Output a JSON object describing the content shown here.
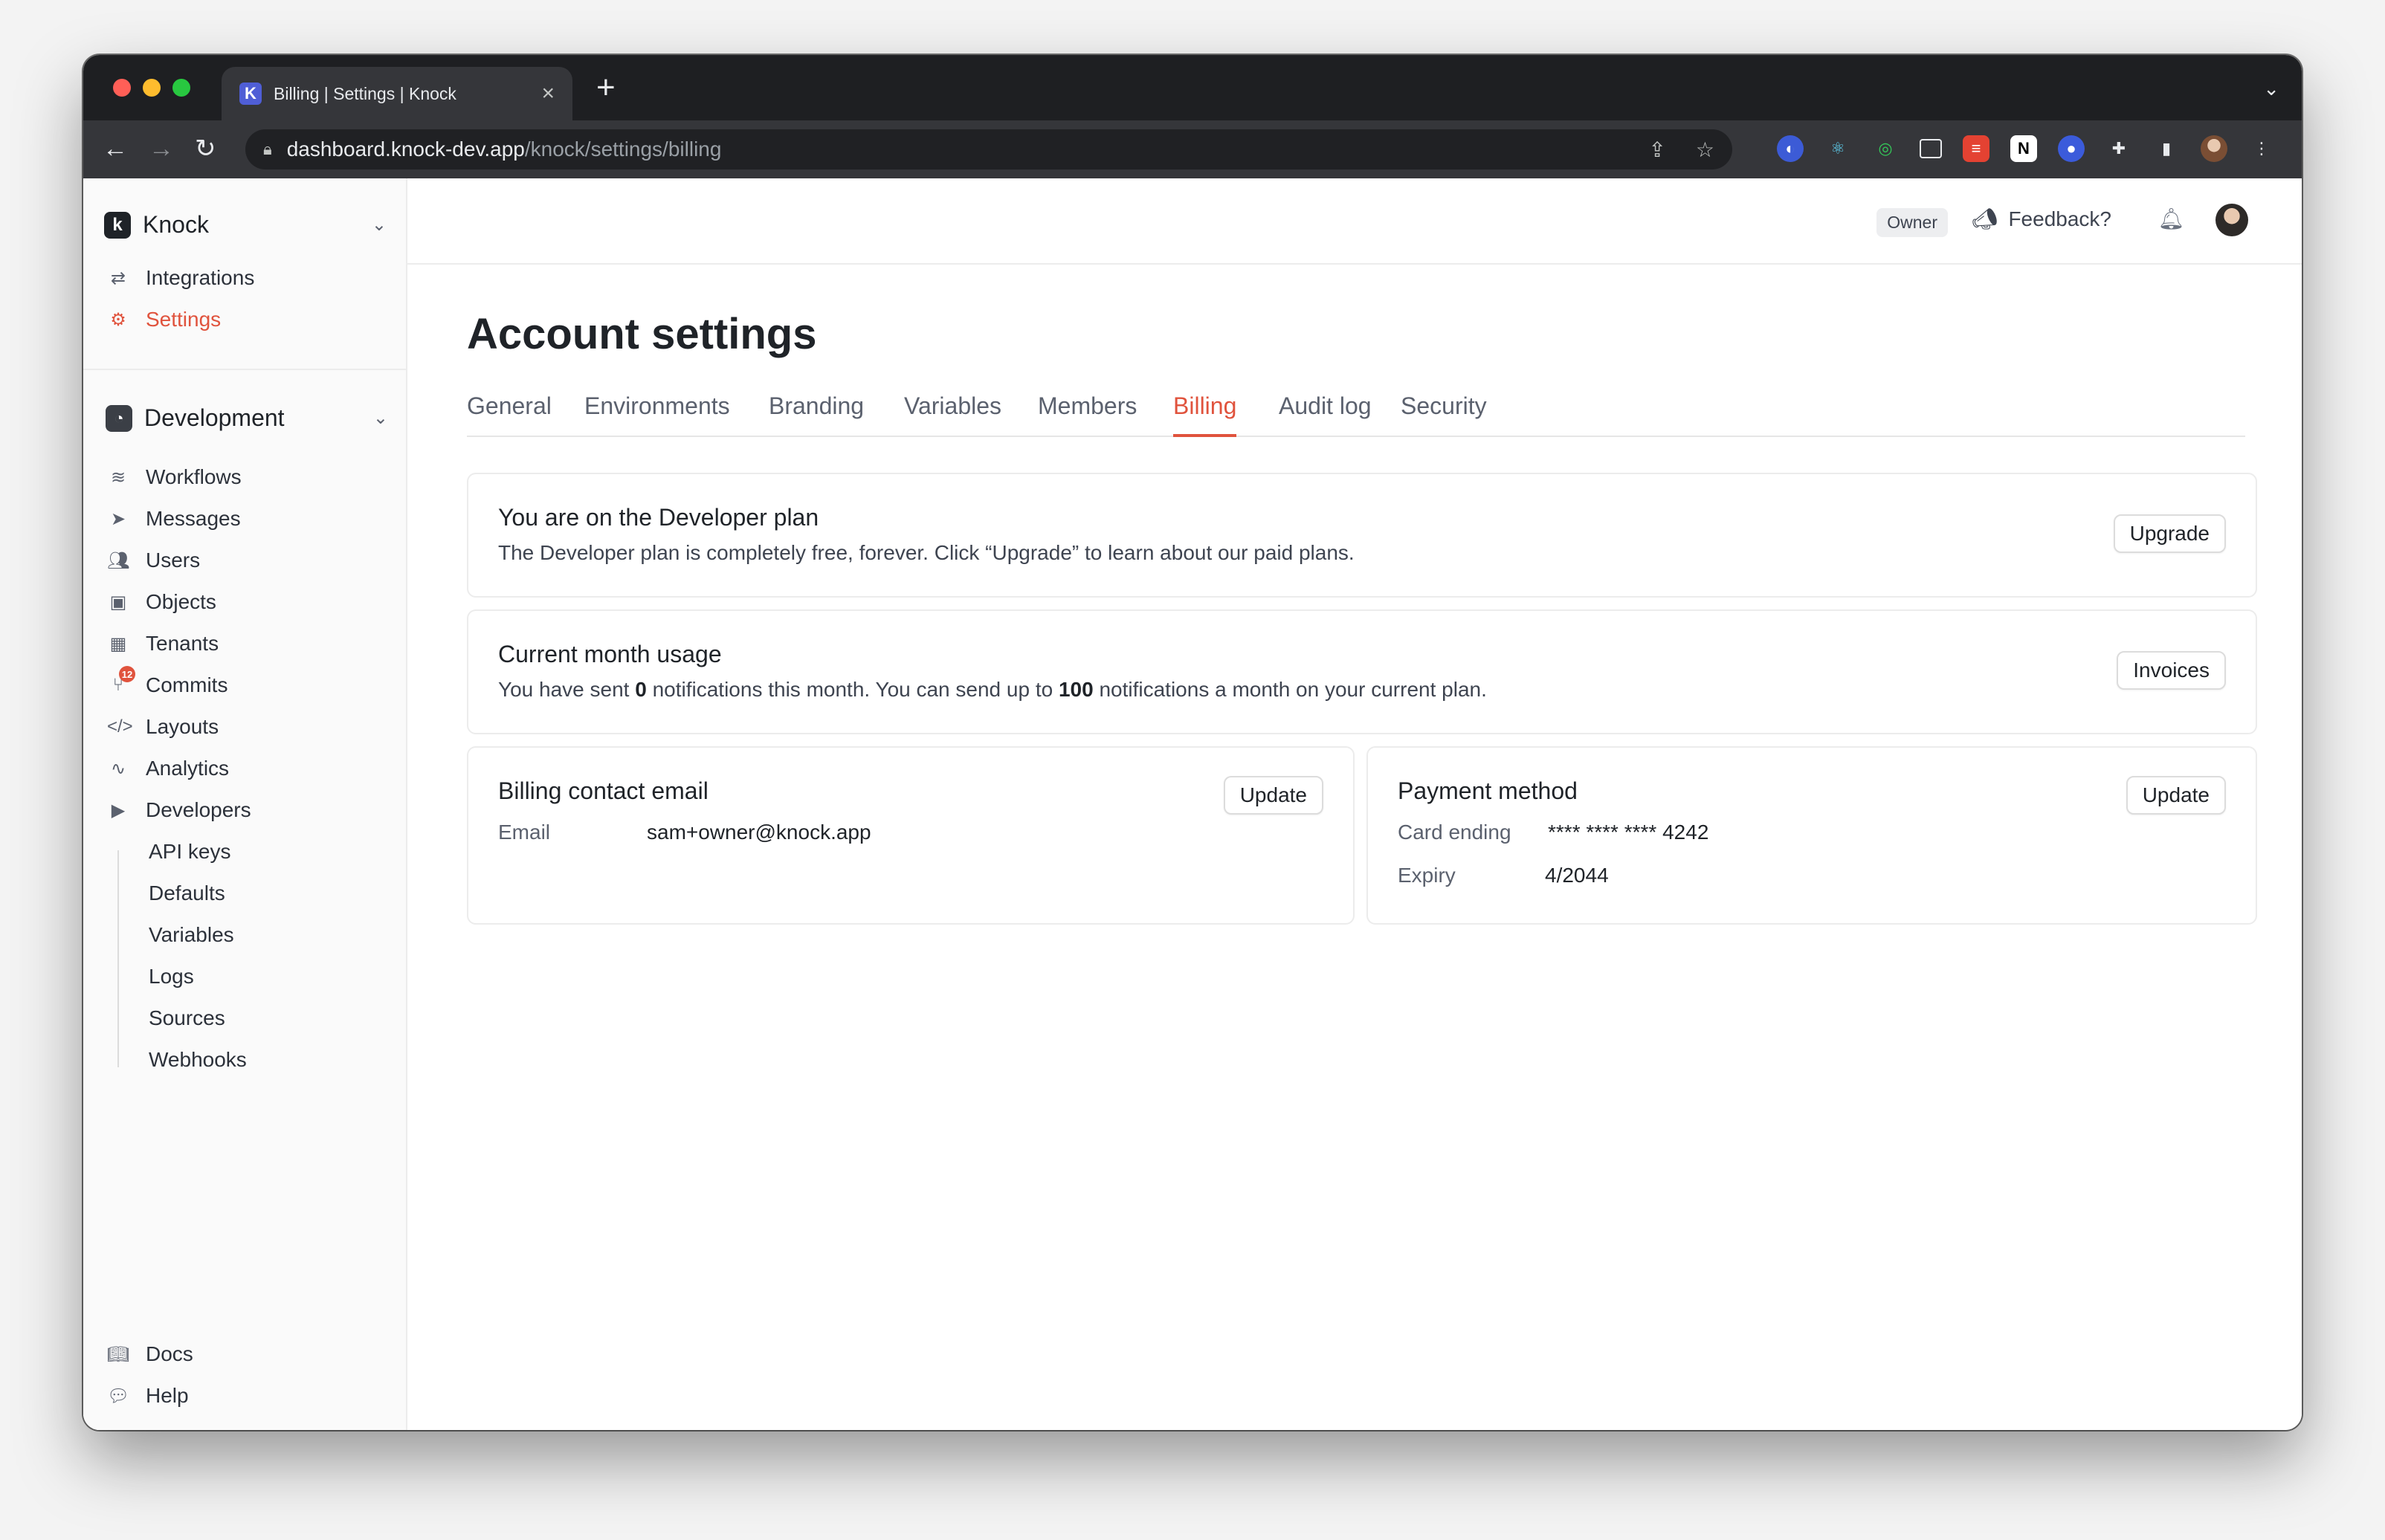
{
  "browser": {
    "tab_title": "Billing | Settings | Knock",
    "tab_favicon_letter": "K",
    "url_host": "dashboard.knock-dev.app",
    "url_path": "/knock/settings/billing"
  },
  "sidebar": {
    "brand": "Knock",
    "top_items": [
      {
        "label": "Integrations",
        "icon": "arrows-exchange-icon"
      },
      {
        "label": "Settings",
        "icon": "gear-icon",
        "active": true
      }
    ],
    "environment": "Development",
    "env_items": [
      {
        "label": "Workflows",
        "icon": "layers-icon"
      },
      {
        "label": "Messages",
        "icon": "paper-plane-icon"
      },
      {
        "label": "Users",
        "icon": "users-icon"
      },
      {
        "label": "Objects",
        "icon": "objects-icon"
      },
      {
        "label": "Tenants",
        "icon": "building-icon"
      },
      {
        "label": "Commits",
        "icon": "git-commit-icon",
        "badge": "12"
      },
      {
        "label": "Layouts",
        "icon": "code-icon"
      },
      {
        "label": "Analytics",
        "icon": "activity-icon"
      },
      {
        "label": "Developers",
        "icon": "terminal-icon"
      }
    ],
    "developer_items": [
      "API keys",
      "Defaults",
      "Variables",
      "Logs",
      "Sources",
      "Webhooks"
    ],
    "bottom_items": [
      {
        "label": "Docs",
        "icon": "book-icon"
      },
      {
        "label": "Help",
        "icon": "chat-icon"
      }
    ]
  },
  "header": {
    "role_badge": "Owner",
    "feedback": "Feedback?"
  },
  "main": {
    "title": "Account settings",
    "tabs": [
      "General",
      "Environments",
      "Branding",
      "Variables",
      "Members",
      "Billing",
      "Audit log",
      "Security"
    ],
    "active_tab": "Billing",
    "plan_card": {
      "title": "You are on the Developer plan",
      "text": "The Developer plan is completely free, forever. Click “Upgrade” to learn about our paid plans.",
      "button": "Upgrade"
    },
    "usage_card": {
      "title": "Current month usage",
      "text_1": "You have sent ",
      "sent": "0",
      "text_2": " notifications this month. You can send up to ",
      "limit": "100",
      "text_3": " notifications a month on your current plan.",
      "button": "Invoices"
    },
    "email_card": {
      "title": "Billing contact email",
      "label": "Email",
      "value": "sam+owner@knock.app",
      "button": "Update"
    },
    "payment_card": {
      "title": "Payment method",
      "card_label": "Card ending",
      "card_value": "**** **** **** 4242",
      "expiry_label": "Expiry",
      "expiry_value": "4/2044",
      "button": "Update"
    }
  }
}
